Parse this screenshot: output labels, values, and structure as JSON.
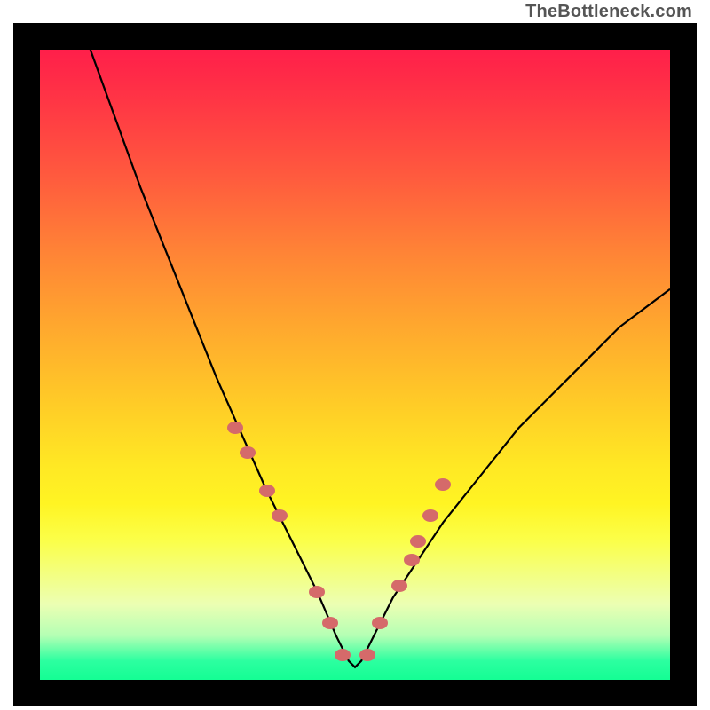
{
  "watermark": "TheBottleneck.com",
  "chart_data": {
    "type": "line",
    "title": "",
    "xlabel": "",
    "ylabel": "",
    "xlim": [
      0,
      100
    ],
    "ylim": [
      0,
      100
    ],
    "grid": false,
    "legend": false,
    "background_gradient": {
      "top": "#ff1f4a",
      "mid": "#ffe824",
      "bottom": "#14fe94"
    },
    "series": [
      {
        "name": "bottleneck-curve",
        "color": "#000000",
        "x": [
          8,
          12,
          16,
          20,
          24,
          28,
          32,
          36,
          40,
          44,
          47,
          49,
          50,
          51,
          53,
          56,
          60,
          64,
          68,
          72,
          76,
          80,
          84,
          88,
          92,
          96,
          100
        ],
        "values": [
          100,
          89,
          78,
          68,
          58,
          48,
          39,
          30,
          22,
          14,
          7,
          3,
          2,
          3,
          7,
          13,
          19,
          25,
          30,
          35,
          40,
          44,
          48,
          52,
          56,
          59,
          62
        ]
      }
    ],
    "markers": {
      "name": "sample-points",
      "color": "#d56a6a",
      "x": [
        31,
        33,
        36,
        38,
        44,
        46,
        48,
        52,
        54,
        57,
        59,
        60,
        62,
        64
      ],
      "values": [
        40,
        36,
        30,
        26,
        14,
        9,
        4,
        4,
        9,
        15,
        19,
        22,
        26,
        31
      ]
    }
  }
}
